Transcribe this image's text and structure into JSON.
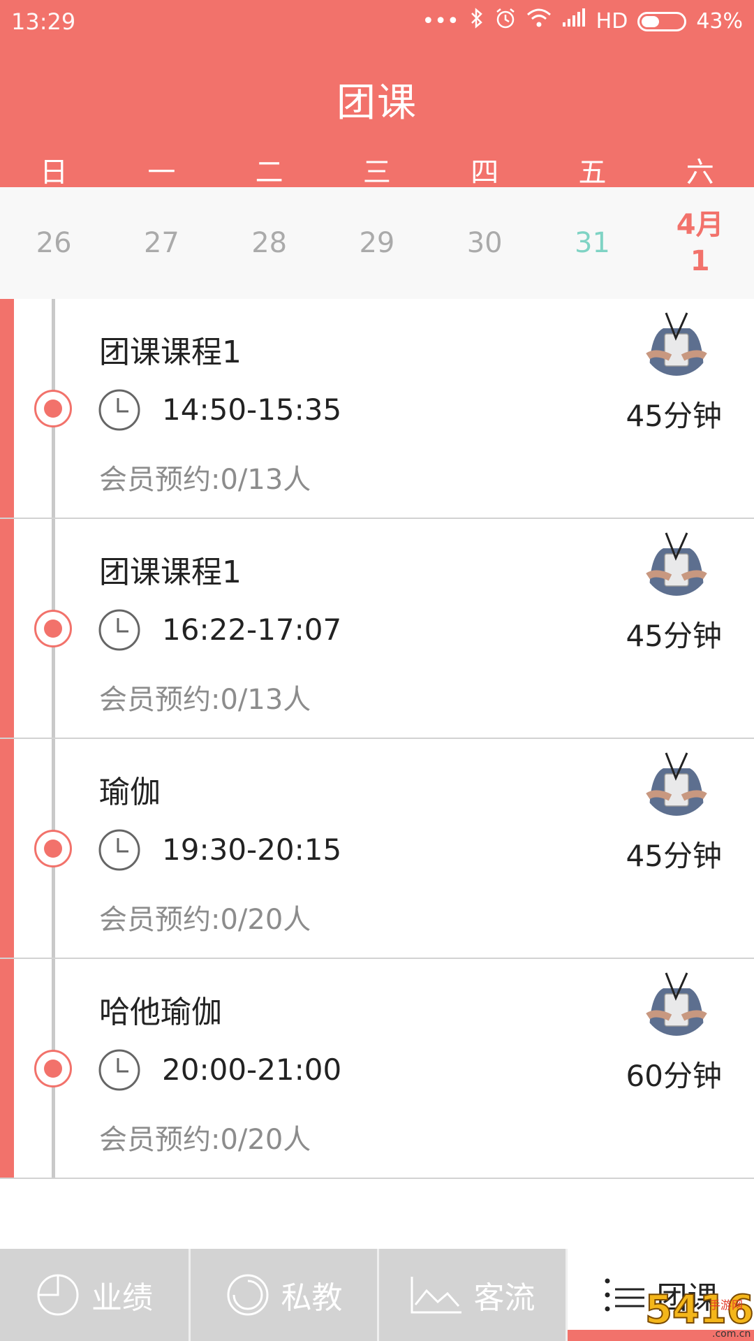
{
  "status_bar": {
    "time": "13:29",
    "network": "HD",
    "battery": "43%",
    "battery_level": 0.43,
    "icons": [
      "more-dots-icon",
      "bluetooth-icon",
      "alarm-icon",
      "wifi-icon",
      "signal-icon",
      "battery-icon"
    ]
  },
  "header": {
    "title": "团课"
  },
  "weekdays": [
    "日",
    "一",
    "二",
    "三",
    "四",
    "五",
    "六"
  ],
  "dates": {
    "d0": "26",
    "d1": "27",
    "d2": "28",
    "d3": "29",
    "d4": "30",
    "d5": "31",
    "selected_month": "4月",
    "selected_day": "1"
  },
  "colors": {
    "accent": "#f2726b",
    "today": "#7fd3c4",
    "muted": "#8c8c8c",
    "tab_inactive": "#d3d3d3"
  },
  "courses": [
    {
      "name": "团课课程1",
      "time": "14:50-15:35",
      "duration": "45分钟",
      "booking": "会员预约:0/13人"
    },
    {
      "name": "团课课程1",
      "time": "16:22-17:07",
      "duration": "45分钟",
      "booking": "会员预约:0/13人"
    },
    {
      "name": "瑜伽",
      "time": "19:30-20:15",
      "duration": "45分钟",
      "booking": "会员预约:0/20人"
    },
    {
      "name": "哈他瑜伽",
      "time": "20:00-21:00",
      "duration": "60分钟",
      "booking": "会员预约:0/20人"
    }
  ],
  "tabs": [
    {
      "label": "业绩",
      "icon": "pie-chart-icon"
    },
    {
      "label": "私教",
      "icon": "ring-icon"
    },
    {
      "label": "客流",
      "icon": "line-chart-icon"
    },
    {
      "label": "团课",
      "icon": "list-icon"
    }
  ],
  "watermark": {
    "text": "5416手游网",
    "subtext": ".com.cn"
  }
}
